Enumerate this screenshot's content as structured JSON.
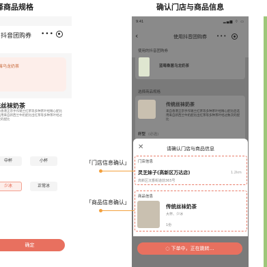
{
  "captions": {
    "left": "择商品规格",
    "center": "确认门店与商品信息"
  },
  "left_phone": {
    "nav_title": "用抖音团购券",
    "more": "•••",
    "voucher_text": "蓝莓乌龙奶茶",
    "product_name": "统丝袜奶茶",
    "product_desc": "来自香港正宗手作锡兰红茶等多种茶叶经精心配比后选用来自新西兰牛奶配比出红茶等多种茶叶经过数次的配比",
    "options_row1": [
      "中杯",
      "小杯"
    ],
    "options_row2": [
      "少冰",
      "正常冰"
    ],
    "selected_option": "少冰",
    "confirm_label": "确定"
  },
  "center_phone": {
    "status_time": "9:41",
    "status_icons": "▂▄▆ ⌔ ▭",
    "nav_back": "‹",
    "nav_title": "使用抖音团购券",
    "nav_more": "•••",
    "voucher_section": "使用的抖音团购券",
    "voucher_name": "蓝莓桑葚乌龙奶茶",
    "spec_section": "选择商品规格",
    "spec_product_name": "传统丝袜奶茶",
    "spec_desc": "来自香港正宗手作锡兰红茶等多种茶叶经精心配比后选用来自新西兰牛奶配比出红茶等多种茶叶经过数次的配比",
    "cup_label": "杯型",
    "cup_hint": "(必选)",
    "modal": {
      "close": "✕",
      "title": "请确认门店与商品信息",
      "store_section": "门店信息",
      "store_name": "灵芝妹子(高新区万达店)",
      "store_distance": "1.2km",
      "store_address": "高新区沉香街道前365号",
      "product_section": "商品信息",
      "product_name": "传统丝袜奶茶",
      "product_spec": "大杯、少冰",
      "product_qty": "1份"
    },
    "loading_label": "下单中，正在跳转…"
  },
  "annotations": {
    "store": "「门店信息确认」",
    "product": "「商品信息确认」"
  },
  "colors": {
    "accent": "#e8705f",
    "annotation": "#f3a03c",
    "overlay": "#7a7a7a"
  }
}
